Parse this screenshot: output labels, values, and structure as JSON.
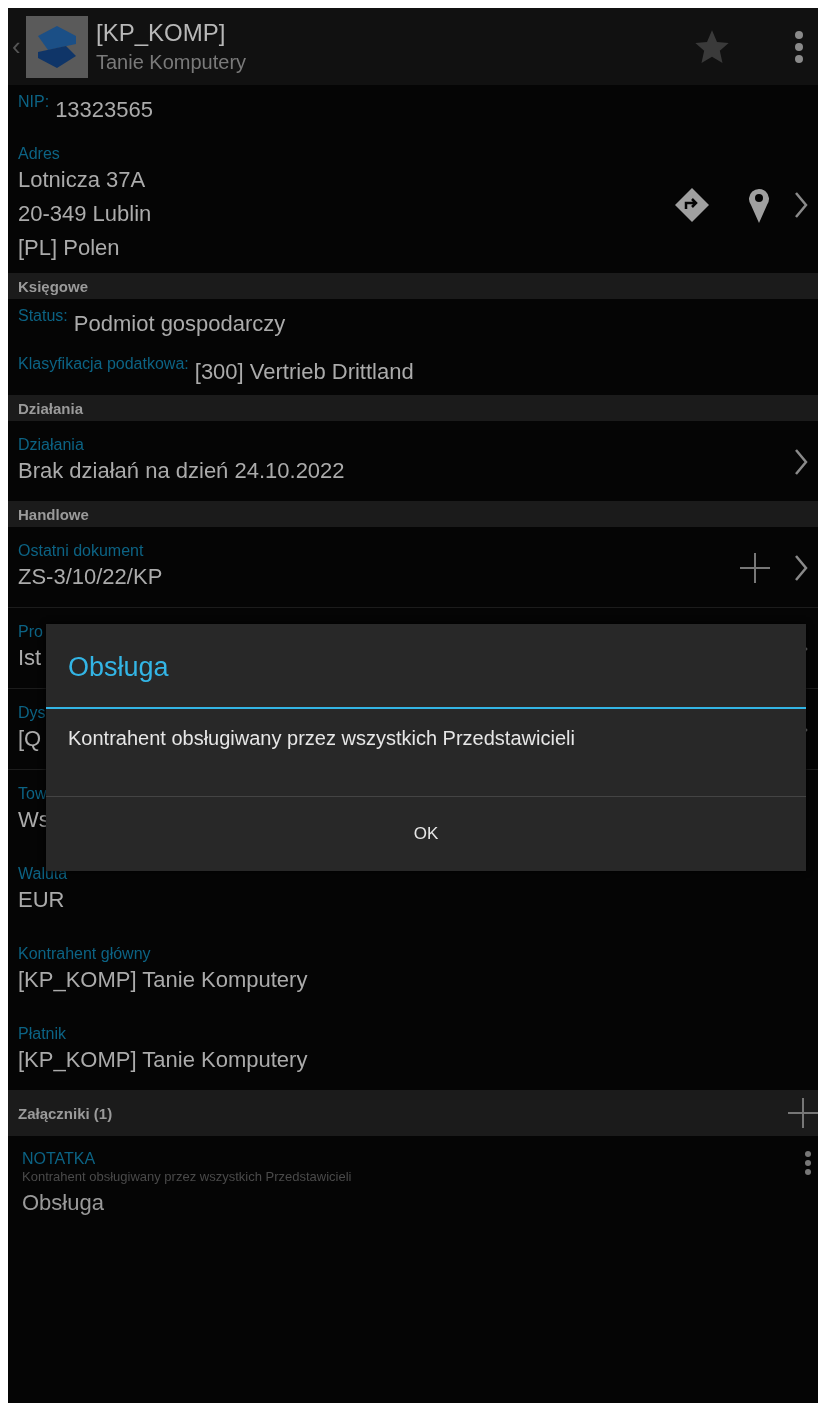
{
  "header": {
    "back": "‹",
    "code": "[KP_KOMP]",
    "name": "Tanie Komputery"
  },
  "top_fields": [
    {
      "kind": "inline",
      "label": "NIP:",
      "value": "13323565"
    },
    {
      "kind": "address",
      "label": "Adres",
      "lines": [
        "Lotnicza 37A",
        "20-349 Lublin",
        "[PL] Polen"
      ]
    }
  ],
  "sections": [
    {
      "title": "Księgowe",
      "fields": [
        {
          "kind": "inline",
          "label": "Status:",
          "value": "Podmiot gospodarczy"
        },
        {
          "kind": "inline",
          "label": "Klasyfikacja podatkowa:",
          "value": "[300] Vertrieb Drittland"
        }
      ]
    },
    {
      "title": "Działania",
      "fields": [
        {
          "kind": "link",
          "label": "Działania",
          "value": "Brak działań na dzień 24.10.2022"
        }
      ]
    },
    {
      "title": "Handlowe",
      "fields": [
        {
          "kind": "document",
          "label": "Ostatni dokument",
          "value": "ZS-3/10/22/KP"
        },
        {
          "kind": "link",
          "label": "Pro",
          "value": "Ist"
        },
        {
          "kind": "link",
          "label": "Dys",
          "value": "[Q"
        },
        {
          "kind": "plain",
          "label": "Tow",
          "value": "Ws"
        },
        {
          "kind": "plain",
          "label": "Waluta",
          "value": "EUR"
        },
        {
          "kind": "plain",
          "label": "Kontrahent główny",
          "value": "[KP_KOMP] Tanie Komputery"
        },
        {
          "kind": "plain",
          "label": "Płatnik",
          "value": "[KP_KOMP] Tanie Komputery"
        }
      ]
    }
  ],
  "attachments": {
    "title": "Załączniki (1)",
    "items": [
      {
        "type": "NOTATKA",
        "description": "Kontrahent obsługiwany przez wszystkich Przedstawicieli",
        "title": "Obsługa"
      }
    ]
  },
  "dialog": {
    "title": "Obsługa",
    "message": "Kontrahent obsługiwany przez wszystkich Przedstawicieli",
    "button": "OK"
  }
}
